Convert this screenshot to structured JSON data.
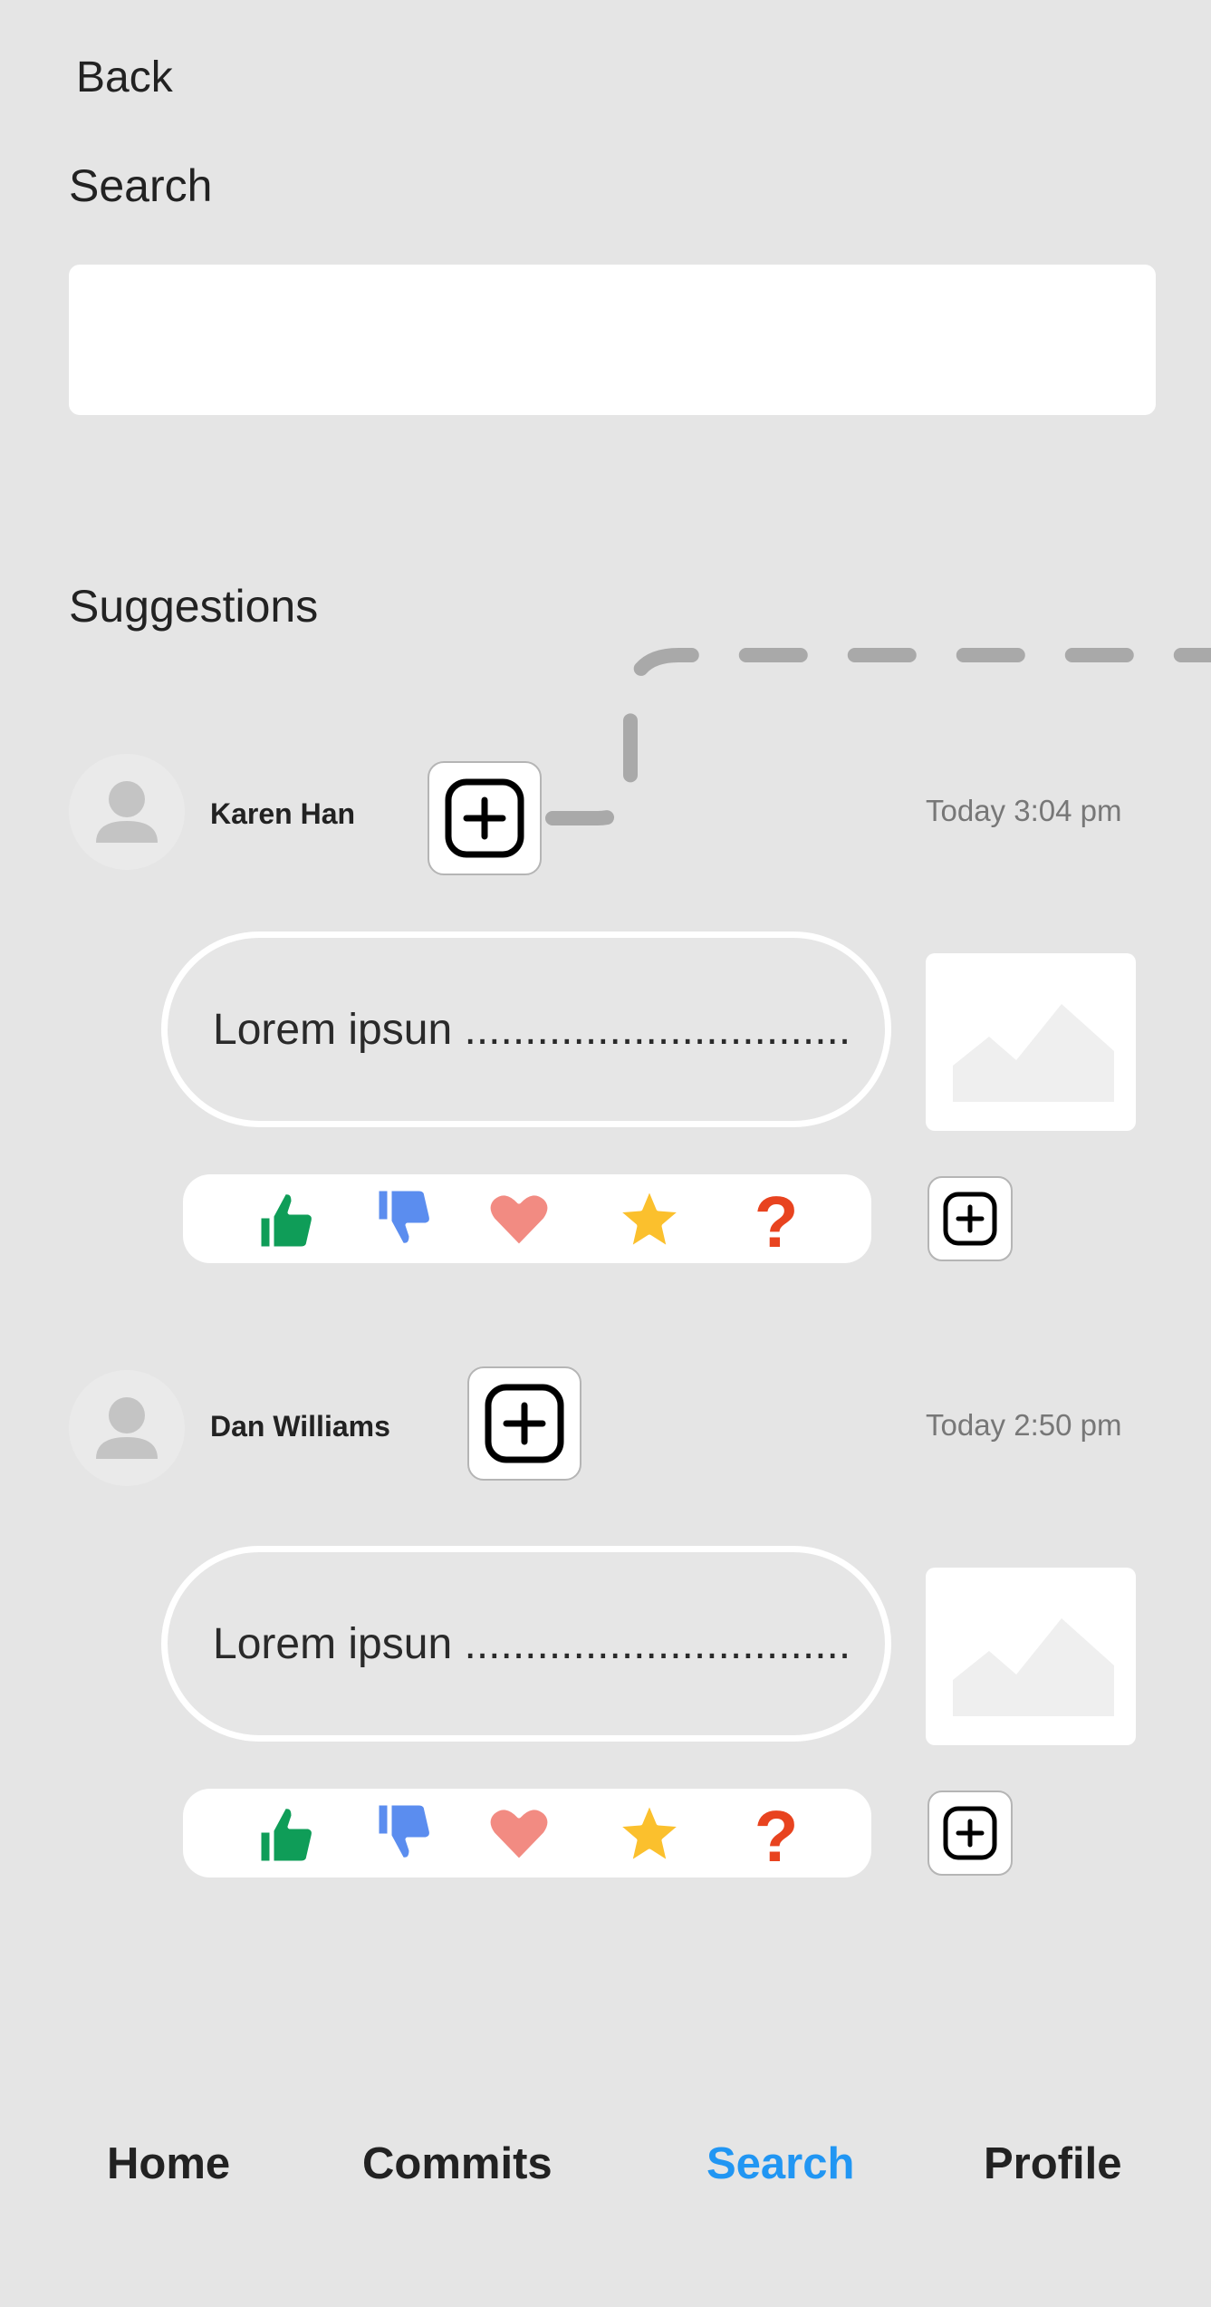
{
  "header": {
    "back_label": "Back"
  },
  "search": {
    "title": "Search",
    "value": "",
    "placeholder": ""
  },
  "suggestions": {
    "title": "Suggestions",
    "items": [
      {
        "user": "Karen Han",
        "time": "Today 3:04 pm",
        "text": "Lorem ipsun ................................"
      },
      {
        "user": "Dan Williams",
        "time": "Today 2:50 pm",
        "text": "Lorem ipsun ................................"
      }
    ]
  },
  "icons": {
    "avatar": "person-icon",
    "add": "plus-square-icon",
    "image": "image-placeholder-icon",
    "reactions": [
      "thumbs-up-icon",
      "thumbs-down-icon",
      "heart-icon",
      "star-icon",
      "question-icon"
    ]
  },
  "nav": {
    "items": [
      {
        "label": "Home"
      },
      {
        "label": "Commits"
      },
      {
        "label": "Search",
        "active": true
      },
      {
        "label": "Profile"
      }
    ]
  },
  "colors": {
    "background": "#e5e5e5",
    "active_nav": "#2196f3",
    "thumbs_up": "#0f9d58",
    "thumbs_down": "#5b8def",
    "heart": "#f28b82",
    "star": "#fbc02d",
    "question": "#e8431f"
  }
}
